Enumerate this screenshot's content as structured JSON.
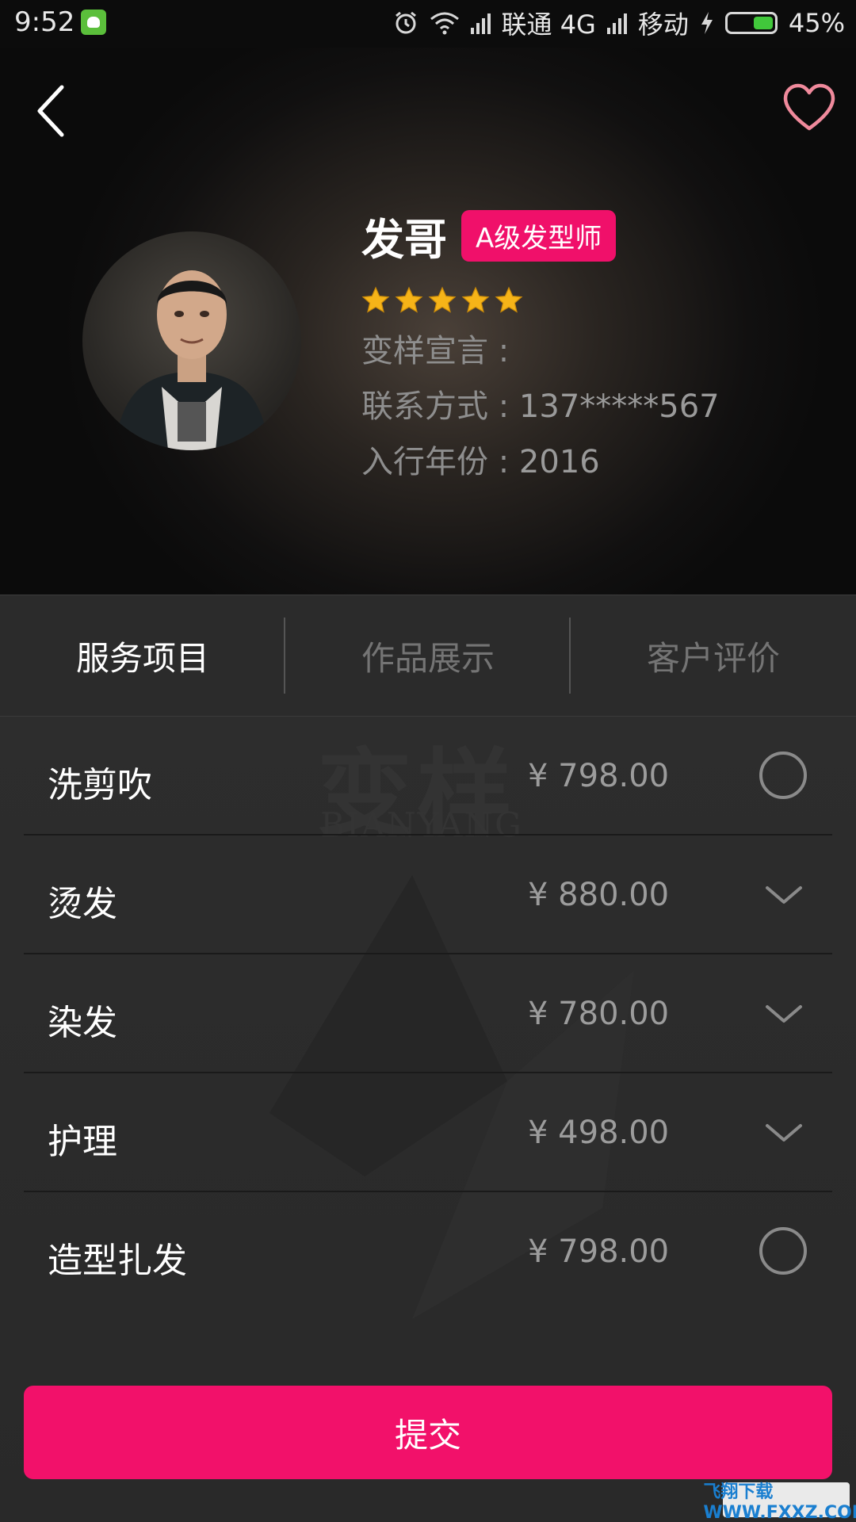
{
  "status_bar": {
    "time": "9:52",
    "watermark": "飞翔下载 www.FXXZ.com",
    "carrier1": "联通 4G",
    "carrier2": "移动",
    "battery": "45%",
    "battery_level": 0.45
  },
  "profile": {
    "name": "发哥",
    "level": "A级发型师",
    "stars": 5,
    "declaration_label": "变样宣言 :",
    "declaration_value": "",
    "contact_label": "联系方式 :",
    "contact_value": "137*****567",
    "year_label": "入行年份 :",
    "year_value": "2016",
    "icons": {
      "back": "back-arrow-icon",
      "favorite": "heart-icon"
    },
    "colors": {
      "badge": "#f0106a",
      "heart": "#f08a9c",
      "star": "#f6b418"
    }
  },
  "tabs": [
    {
      "label": "服务项目",
      "active": true
    },
    {
      "label": "作品展示",
      "active": false
    },
    {
      "label": "客户评价",
      "active": false
    }
  ],
  "background_logo": {
    "main": "变样",
    "sub": "BIANYANG"
  },
  "services": [
    {
      "name": "洗剪吹",
      "price": "¥ 798.00",
      "control": "radio"
    },
    {
      "name": "烫发",
      "price": "¥ 880.00",
      "control": "chevron"
    },
    {
      "name": "染发",
      "price": "¥ 780.00",
      "control": "chevron"
    },
    {
      "name": "护理",
      "price": "¥ 498.00",
      "control": "chevron"
    },
    {
      "name": "造型扎发",
      "price": "¥ 798.00",
      "control": "radio"
    }
  ],
  "submit": {
    "label": "提交",
    "color": "#f2116a"
  },
  "watermark_bottom": "飞翔下载 WWW.FXXZ.COM"
}
